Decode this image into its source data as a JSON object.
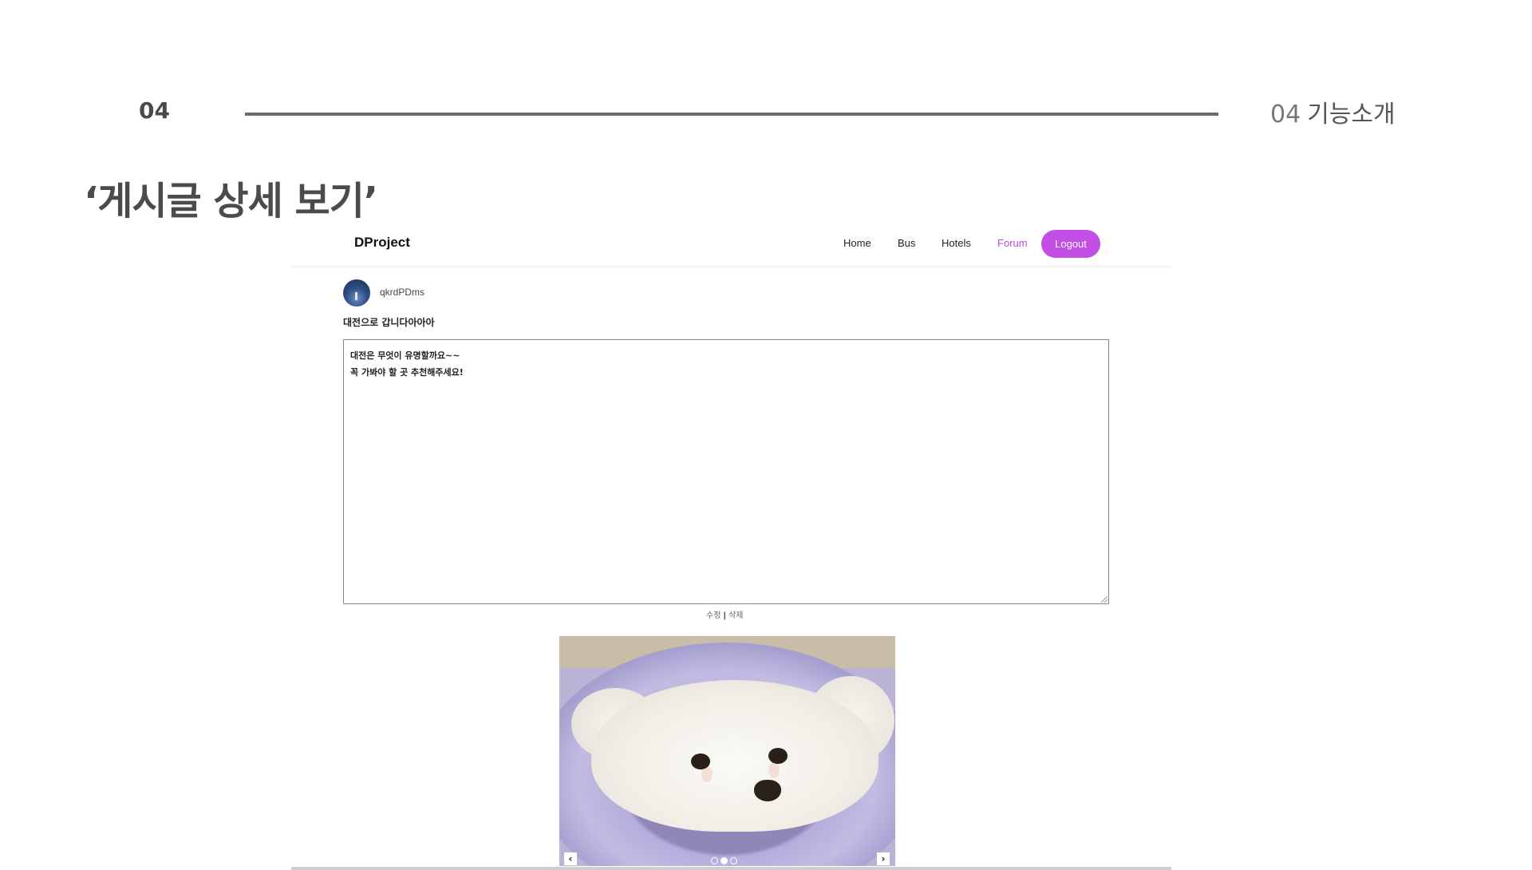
{
  "slide": {
    "number": "04",
    "section_number": "04",
    "section_title": "기능소개",
    "title": "‘게시글 상세 보기’"
  },
  "navbar": {
    "brand": "DProject",
    "links": [
      "Home",
      "Bus",
      "Hotels",
      "Forum"
    ],
    "active_link": "Forum",
    "logout_label": "Logout",
    "accent_color": "#c24ee6"
  },
  "post": {
    "username": "qkrdPDms",
    "title": "대전으로 갑니다아아아",
    "content_lines": [
      "대전은 무엇이 유명할까요~~",
      "꼭 가봐야 할 곳 추천해주세요!"
    ],
    "edit_label": "수정",
    "separator": "|",
    "delete_label": "삭제"
  },
  "carousel": {
    "prev_icon": "‹",
    "next_icon": "›",
    "slide_count": 3,
    "active_index": 1
  }
}
